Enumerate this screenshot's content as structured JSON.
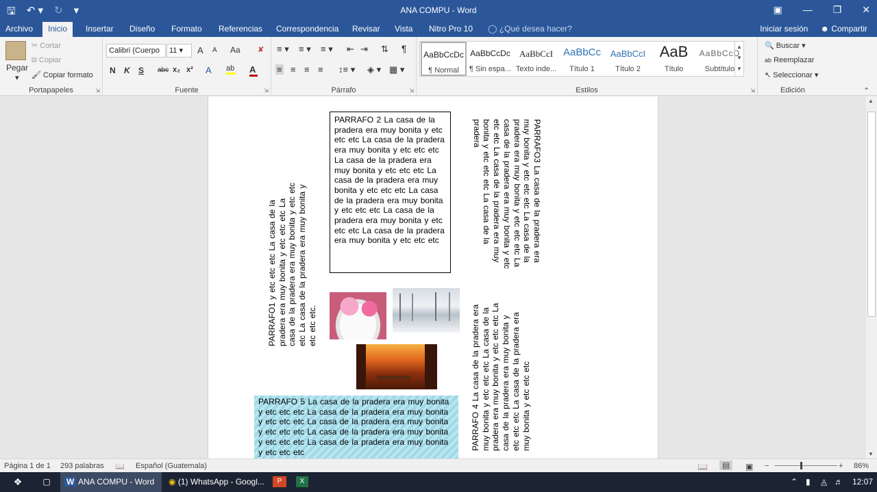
{
  "window": {
    "title": "ANA COMPU - Word"
  },
  "qat": {
    "save_icon": "save-icon",
    "undo_icon": "undo-icon",
    "redo_icon": "redo-icon",
    "customize_icon": "customize-qat-icon"
  },
  "tabs": [
    "Archivo",
    "Inicio",
    "Insertar",
    "Diseño",
    "Formato",
    "Referencias",
    "Correspondencia",
    "Revisar",
    "Vista",
    "Nitro Pro 10"
  ],
  "tell_me": "¿Qué desea hacer?",
  "account": {
    "signin": "Iniciar sesión",
    "share": "Compartir"
  },
  "ribbon": {
    "clipboard": {
      "label": "Portapapeles",
      "paste": "Pegar",
      "cut": "Cortar",
      "copy": "Copiar",
      "format_painter": "Copiar formato"
    },
    "font": {
      "label": "Fuente",
      "font_name": "Calibri (Cuerpo",
      "font_size": "11",
      "bold": "N",
      "italic": "K",
      "underline": "S",
      "strike": "abc",
      "sub": "x₂",
      "sup": "x²",
      "case": "Aa",
      "grow": "A",
      "shrink": "A",
      "clear": "A",
      "highlight_color": "#ffff00",
      "font_color": "#c00000"
    },
    "paragraph": {
      "label": "Párrafo"
    },
    "styles": {
      "label": "Estilos",
      "items": [
        {
          "preview": "AaBbCcDc",
          "name": "¶ Normal"
        },
        {
          "preview": "AaBbCcDc",
          "name": "¶ Sin espa..."
        },
        {
          "preview": "AaBbCcI",
          "name": "Texto inde..."
        },
        {
          "preview": "AaBbCc",
          "name": "Título 1"
        },
        {
          "preview": "AaBbCcI",
          "name": "Título 2"
        },
        {
          "preview": "AaB",
          "name": "Título"
        },
        {
          "preview": "AaBbCcD",
          "name": "Subtítulo"
        }
      ]
    },
    "editing": {
      "label": "Edición",
      "find": "Buscar",
      "replace": "Reemplazar",
      "select": "Seleccionar"
    }
  },
  "document": {
    "p1": "PARRAFO1 y etc etc etc La casa de la pradera era muy bonita y etc etc etc La casa de la pradera era muy bonita y etc etc etc La casa de la pradera era muy bonita y etc etc etc.",
    "p2": "PARRAFO 2 La casa de la pradera era muy bonita y etc etc etc La casa de la pradera era muy bonita y etc etc etc La casa de la pradera era muy bonita y etc etc etc La casa de la pradera era muy bonita y etc etc etc La casa de la pradera era muy bonita y etc etc etc La casa de la pradera era muy bonita y etc etc etc La casa de la pradera era muy bonita y etc etc etc",
    "p3": "PARRAFO3 La casa de la pradera era muy bonita y etc etc etc La casa de la pradera era muy bonita y etc etc etc La casa de la pradera era muy bonita y etc etc etc La casa de la pradera era muy bonita y etc etc etc La casa de la pradera",
    "p4": "PARRAFO 4 La casa de la pradera era muy bonita y etc etc etc La casa de la pradera era muy bonita y etc etc etc La casa de la pradera era muy bonita y etc etc etc La casa de la pradera era muy bonita y etc etc etc",
    "p5": "PARRAFO 5 La casa de la pradera era muy bonita y etc etc etc La casa de la pradera era muy bonita y etc etc etc La casa de la pradera era muy bonita y etc etc etc La casa de la pradera era muy bonita y etc etc etc La casa de la pradera era muy bonita y etc etc etc"
  },
  "status": {
    "page": "Página 1 de 1",
    "words": "293 palabras",
    "language": "Español (Guatemala)",
    "zoom": "86%",
    "zoom_value": 86
  },
  "taskbar": {
    "word": "ANA COMPU - Word",
    "chrome": "(1) WhatsApp - Googl...",
    "time": "12:07"
  }
}
